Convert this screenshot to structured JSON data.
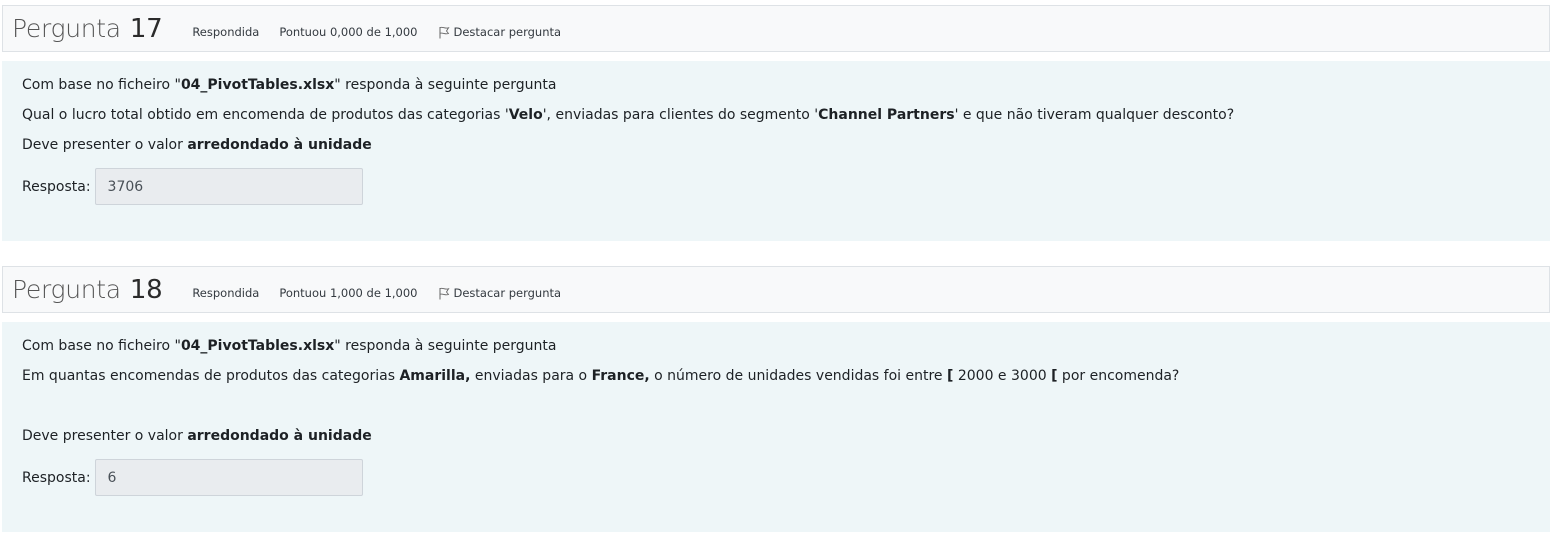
{
  "questions": [
    {
      "title_word": "Pergunta",
      "number": "17",
      "state": "Respondida",
      "grade": "Pontuou 0,000 de 1,000",
      "flag_label": "Destacar pergunta",
      "line1_pre": "Com base no ficheiro \"",
      "line1_bold": "04_PivotTables.xlsx",
      "line1_post": "\" responda à seguinte pergunta",
      "line2_a": "Qual o lucro total obtido em encomenda de produtos das categorias '",
      "line2_b": "Velo",
      "line2_c": "',  enviadas para clientes do segmento '",
      "line2_d": "Channel Partners",
      "line2_e": "' e que não tiveram qualquer desconto?",
      "line3_pre": "Deve presenter o valor ",
      "line3_bold": "arredondado à unidade",
      "answer_label": "Resposta:",
      "answer_value": "3706"
    },
    {
      "title_word": "Pergunta",
      "number": "18",
      "state": "Respondida",
      "grade": "Pontuou 1,000 de 1,000",
      "flag_label": "Destacar pergunta",
      "line1_pre": "Com base no ficheiro \"",
      "line1_bold": "04_PivotTables.xlsx",
      "line1_post": "\" responda à seguinte pergunta",
      "line2_a": "Em quantas encomendas de produtos das categorias ",
      "line2_b": "Amarilla,",
      "line2_c": "   enviadas para o ",
      "line2_d": "France,",
      "line2_e": "  o número de unidades vendidas foi entre ",
      "line2_f": "[",
      "line2_g": " 2000 e 3000 ",
      "line2_h": "[",
      "line2_i": "  por encomenda?",
      "line3_pre": "Deve presenter o valor ",
      "line3_bold": "arredondado à unidade",
      "answer_label": "Resposta:",
      "answer_value": "6"
    }
  ],
  "icons": {
    "flag": "flag-outline-icon"
  },
  "colors": {
    "header_bg": "#f8f9fa",
    "body_bg": "#eef6f8",
    "input_bg": "#e9ecef",
    "border": "#dee2e6"
  }
}
